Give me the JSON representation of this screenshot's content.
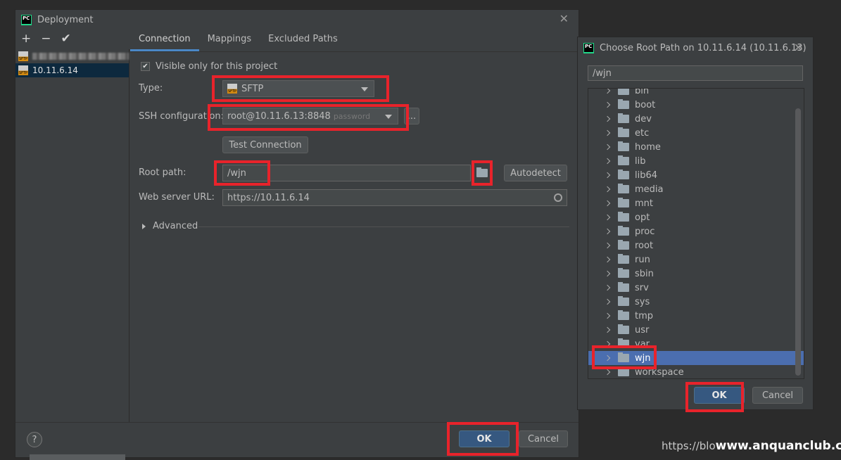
{
  "deployment": {
    "title": "Deployment",
    "toolbar": {
      "add": "+",
      "remove": "−",
      "apply": "✔"
    },
    "servers": [
      {
        "label": "10.11.6.14",
        "selected": true
      }
    ],
    "tabs": [
      "Connection",
      "Mappings",
      "Excluded Paths"
    ],
    "visible_only": "Visible only for this project",
    "type_label": "Type:",
    "type_value": "SFTP",
    "ssh_label": "SSH configuration:",
    "ssh_value": "root@10.11.6.13:8848",
    "ssh_hint": "password",
    "ssh_more": "...",
    "test_connection": "Test Connection",
    "root_path_label": "Root path:",
    "root_path_value": "/wjn",
    "autodetect": "Autodetect",
    "web_url_label": "Web server URL:",
    "web_url_value": "https://10.11.6.14",
    "advanced": "Advanced",
    "help": "?",
    "ok": "OK",
    "cancel": "Cancel"
  },
  "chooser": {
    "title": "Choose Root Path on 10.11.6.14 (10.11.6.13)",
    "path_value": "/wjn",
    "folders": [
      "bin",
      "boot",
      "dev",
      "etc",
      "home",
      "lib",
      "lib64",
      "media",
      "mnt",
      "opt",
      "proc",
      "root",
      "run",
      "sbin",
      "srv",
      "sys",
      "tmp",
      "usr",
      "var",
      "wjn",
      "workspace"
    ],
    "selected_folder": "wjn",
    "ok": "OK",
    "cancel": "Cancel"
  },
  "watermark": {
    "prefix": "https://blo",
    "brand": "www.anquanclub.cn"
  },
  "colors": {
    "accent": "#4a88c7",
    "highlight": "#e8232b",
    "selection": "#4b6eaf",
    "primary_button": "#365880"
  }
}
